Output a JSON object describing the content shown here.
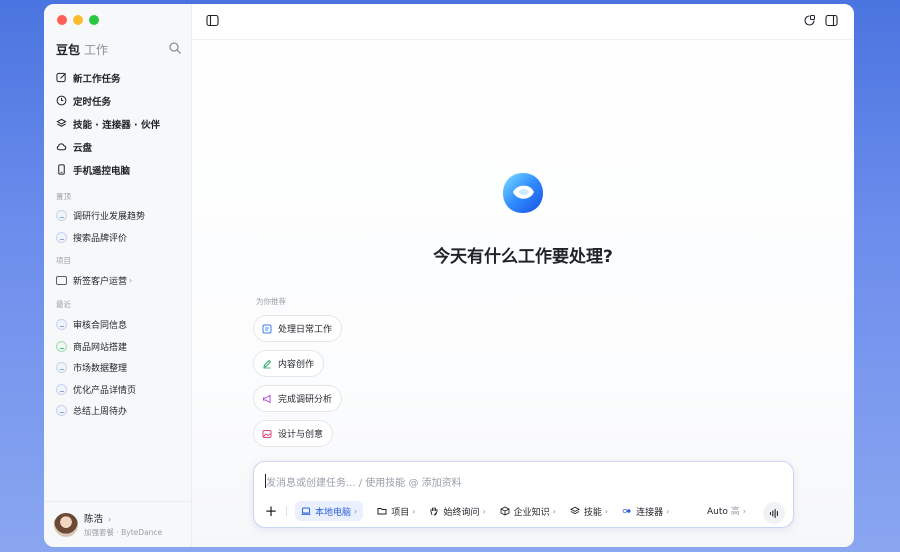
{
  "sidebar": {
    "brand": "豆包",
    "brand_sub": "工作",
    "nav": [
      {
        "label": "新工作任务",
        "icon": "edit-icon"
      },
      {
        "label": "定时任务",
        "icon": "clock-icon"
      },
      {
        "label": "技能 · 连接器 · 伙伴",
        "icon": "layers-icon"
      },
      {
        "label": "云盘",
        "icon": "cloud-icon"
      },
      {
        "label": "手机遥控电脑",
        "icon": "phone-icon"
      }
    ],
    "pinned_label": "置顶",
    "pinned": [
      "调研行业发展趋势",
      "搜索品牌评价"
    ],
    "projects_label": "项目",
    "projects": [
      {
        "label": "新签客户运营",
        "chevron": "›"
      }
    ],
    "recent_label": "最近",
    "recent": [
      "审核合同信息",
      "商品网站搭建",
      "市场数据整理",
      "优化产品详情页",
      "总结上周待办"
    ],
    "user": {
      "name": "陈浩",
      "chevron": "›",
      "sub": "加强套餐 · ByteDance"
    }
  },
  "main": {
    "headline": "今天有什么工作要处理?",
    "rec_label": "为你推荐",
    "suggestions": [
      {
        "label": "处理日常工作",
        "icon": "doc-icon",
        "color": "#3b7bf6"
      },
      {
        "label": "内容创作",
        "icon": "pen-icon",
        "color": "#2fa86b"
      },
      {
        "label": "完成调研分析",
        "icon": "megaphone-icon",
        "color": "#b04ad6"
      },
      {
        "label": "设计与创意",
        "icon": "image-icon",
        "color": "#e0457a"
      }
    ],
    "composer": {
      "placeholder": "发消息或创建任务... / 使用技能 @ 添加资料",
      "plus": "+",
      "tools": [
        {
          "label": "本地电脑",
          "icon": "laptop-icon",
          "chevron": "›",
          "active": true
        },
        {
          "label": "项目",
          "icon": "folder-icon",
          "chevron": "›"
        },
        {
          "label": "始终询问",
          "icon": "hand-icon",
          "chevron": "›"
        },
        {
          "label": "企业知识",
          "icon": "cube-icon",
          "chevron": "›"
        },
        {
          "label": "技能",
          "icon": "stack-icon",
          "chevron": "›"
        },
        {
          "label": "连接器",
          "icon": "connector-icon",
          "chevron": "›"
        }
      ],
      "auto_label": "Auto",
      "auto_level": "高",
      "auto_chevron": "›"
    }
  },
  "colors": {
    "accent": "#2b5fd9",
    "traffic_red": "#ff5f57",
    "traffic_yellow": "#febc2e",
    "traffic_green": "#28c840"
  }
}
